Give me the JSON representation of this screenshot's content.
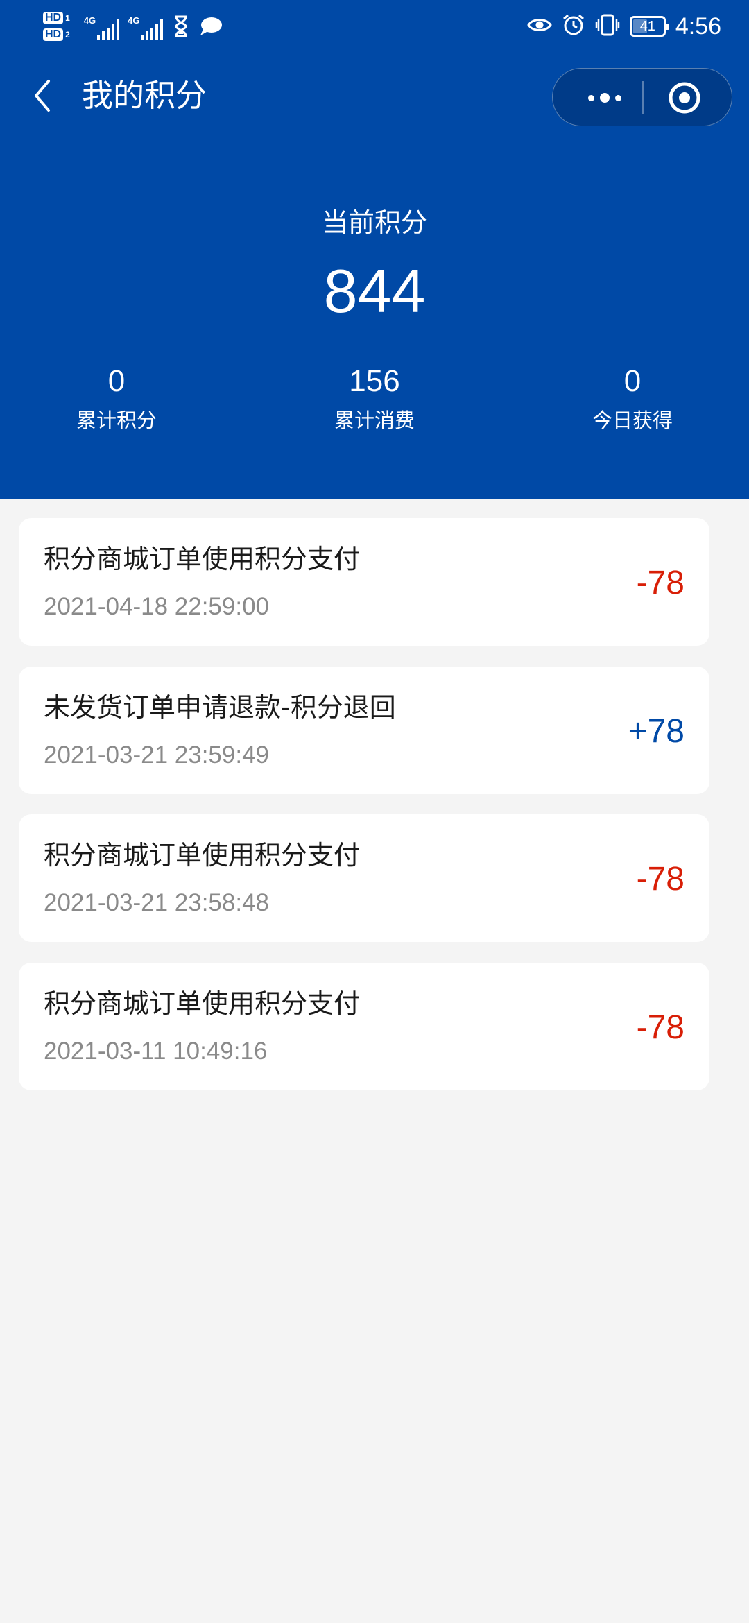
{
  "status_bar": {
    "hd1": "HD",
    "hd1_sub": "1",
    "hd2": "HD",
    "hd2_sub": "2",
    "net1": "4G",
    "net2": "4G",
    "battery": "41",
    "time": "4:56"
  },
  "nav": {
    "title": "我的积分"
  },
  "summary": {
    "current_label": "当前积分",
    "current_value": "844",
    "stats": [
      {
        "value": "0",
        "label": "累计积分"
      },
      {
        "value": "156",
        "label": "累计消费"
      },
      {
        "value": "0",
        "label": "今日获得"
      }
    ]
  },
  "records": [
    {
      "title": "积分商城订单使用积分支付",
      "time": "2021-04-18 22:59:00",
      "amount": "-78",
      "type": "neg"
    },
    {
      "title": "未发货订单申请退款-积分退回",
      "time": "2021-03-21 23:59:49",
      "amount": "+78",
      "type": "pos"
    },
    {
      "title": "积分商城订单使用积分支付",
      "time": "2021-03-21 23:58:48",
      "amount": "-78",
      "type": "neg"
    },
    {
      "title": "积分商城订单使用积分支付",
      "time": "2021-03-11 10:49:16",
      "amount": "-78",
      "type": "neg"
    }
  ],
  "colors": {
    "header_bg": "#0049a6",
    "negative": "#d81e06",
    "positive": "#0049a6",
    "page_bg": "#f4f4f4"
  }
}
